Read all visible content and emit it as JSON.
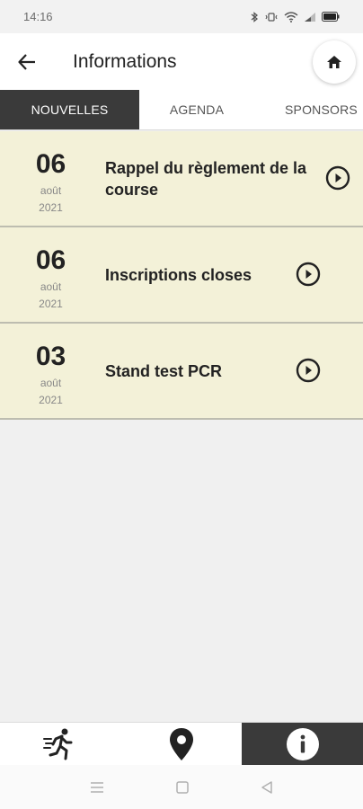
{
  "status_bar": {
    "time": "14:16"
  },
  "header": {
    "title": "Informations"
  },
  "tabs": [
    {
      "label": "NOUVELLES",
      "active": true
    },
    {
      "label": "AGENDA",
      "active": false
    },
    {
      "label": "SPONSORS",
      "active": false
    }
  ],
  "news": [
    {
      "day": "06",
      "month": "août",
      "year": "2021",
      "title": "Rappel du règlement de la course"
    },
    {
      "day": "06",
      "month": "août",
      "year": "2021",
      "title": "Inscriptions closes"
    },
    {
      "day": "03",
      "month": "août",
      "year": "2021",
      "title": "Stand test PCR"
    }
  ],
  "bottom_nav": [
    {
      "icon": "runner-icon",
      "active": false
    },
    {
      "icon": "location-pin-icon",
      "active": false
    },
    {
      "icon": "info-icon",
      "active": true
    }
  ],
  "colors": {
    "item_bg": "#f3f1d8",
    "active_dark": "#3a3a3a"
  }
}
